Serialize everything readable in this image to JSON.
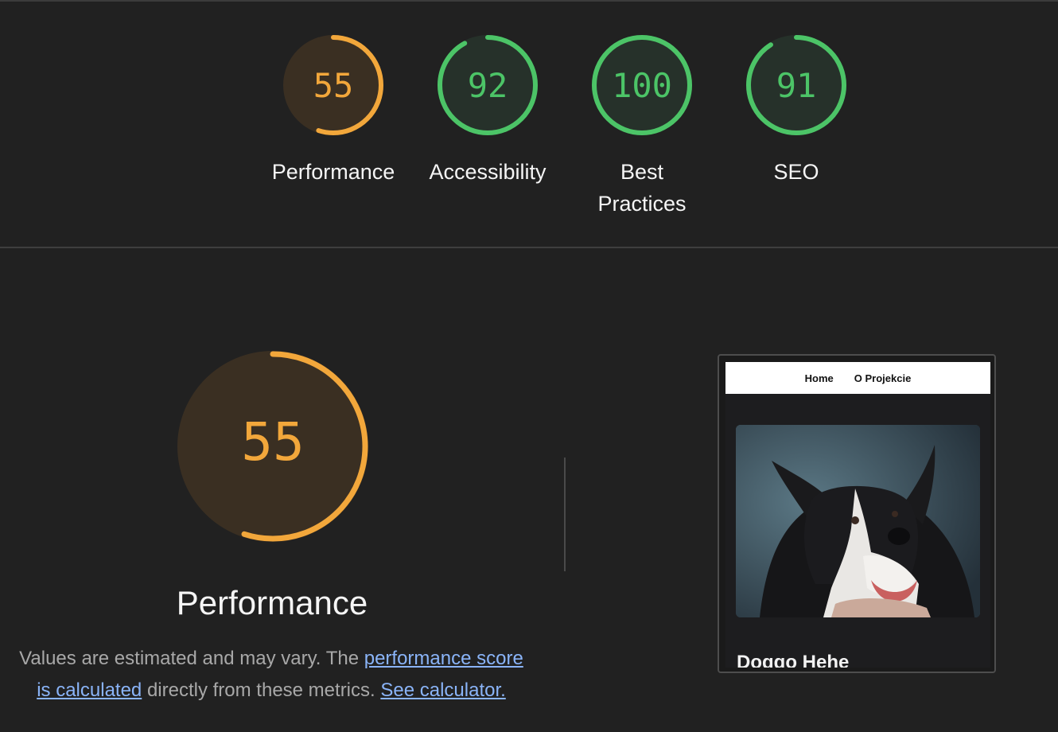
{
  "summary": {
    "gauges": [
      {
        "id": "performance",
        "score": "55",
        "score_value": 55,
        "label": "Performance",
        "color": "#f2a73b",
        "fill": "#3a2f22"
      },
      {
        "id": "accessibility",
        "score": "92",
        "score_value": 92,
        "label": "Accessibility",
        "color": "#4cc467",
        "fill": "#26312a"
      },
      {
        "id": "best-practices",
        "score": "100",
        "score_value": 100,
        "label": "Best Practices",
        "color": "#4cc467",
        "fill": "#26312a"
      },
      {
        "id": "seo",
        "score": "91",
        "score_value": 91,
        "label": "SEO",
        "color": "#4cc467",
        "fill": "#26312a"
      }
    ]
  },
  "performance": {
    "score": "55",
    "score_value": 55,
    "label": "Performance",
    "color": "#f2a73b",
    "fill": "#3a2f22",
    "description": {
      "text1": "Values are estimated and may vary. The ",
      "link1": "performance score is calculated",
      "text2": " directly from these metrics. ",
      "link2": "See calculator."
    }
  },
  "thumbnail": {
    "nav": [
      "Home",
      "O Projekcie"
    ],
    "heading": "Doggo Hehe"
  },
  "colors": {
    "background": "#212121",
    "link": "#8ab4f8",
    "muted_text": "#a8a8a8"
  }
}
